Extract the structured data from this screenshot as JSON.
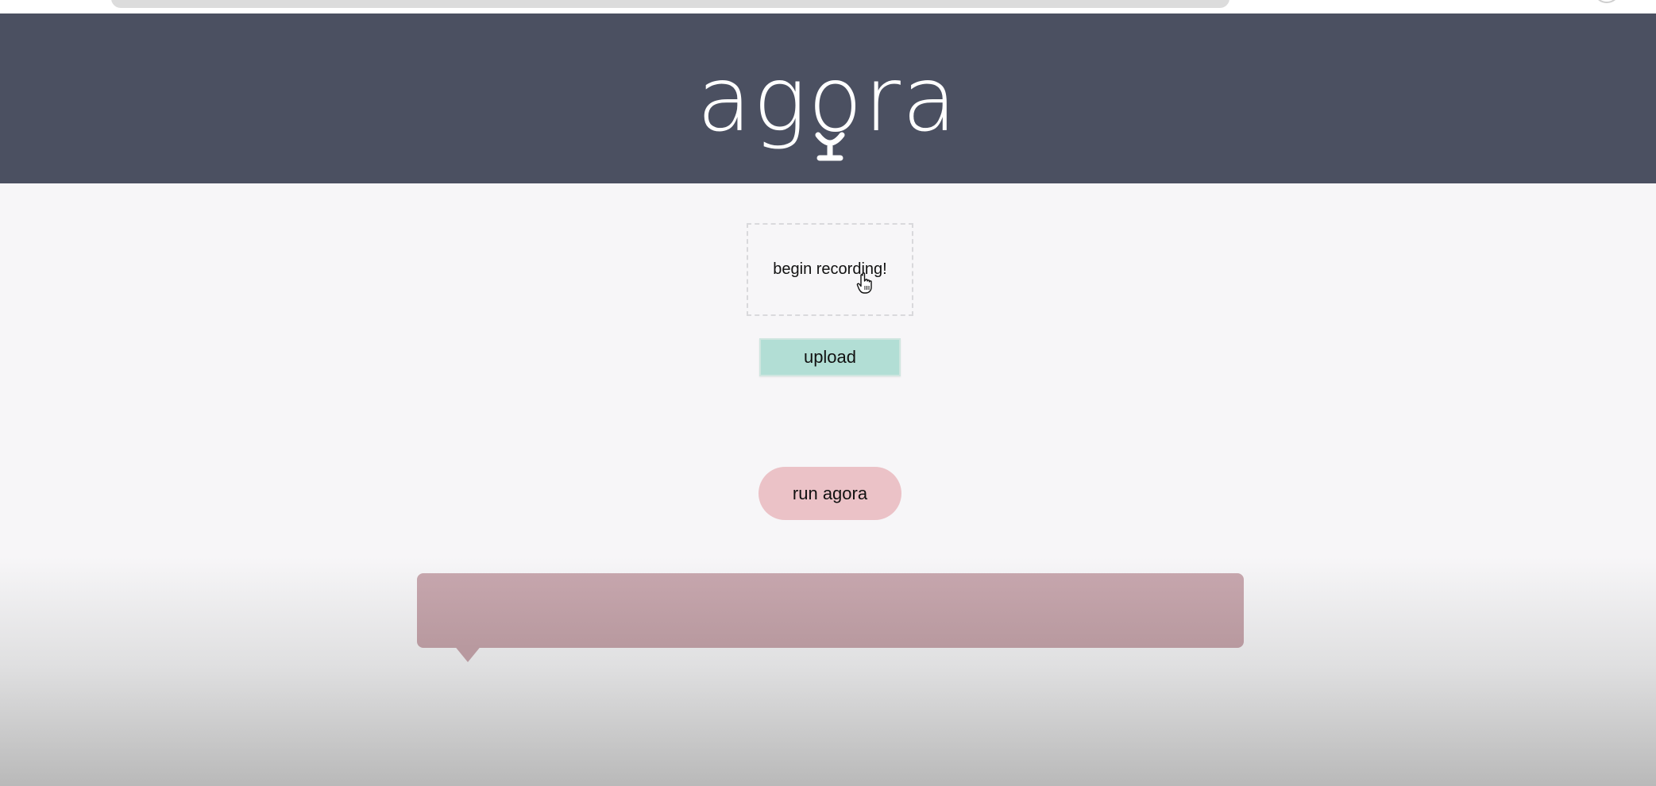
{
  "app": {
    "logo_text": "agora"
  },
  "recorder": {
    "label": "begin recording!"
  },
  "actions": {
    "upload_label": "upload",
    "run_label": "run agora"
  },
  "output": {
    "text": ""
  },
  "colors": {
    "header_bg": "#4b5061",
    "page_bg": "#f7f6f8",
    "upload_bg": "#b2ded5",
    "run_bg": "#ebc2c7",
    "output_bg": "#c6a6ad"
  },
  "icons": {
    "logo": "microphone-logo",
    "cursor": "hand-pointer-icon"
  }
}
